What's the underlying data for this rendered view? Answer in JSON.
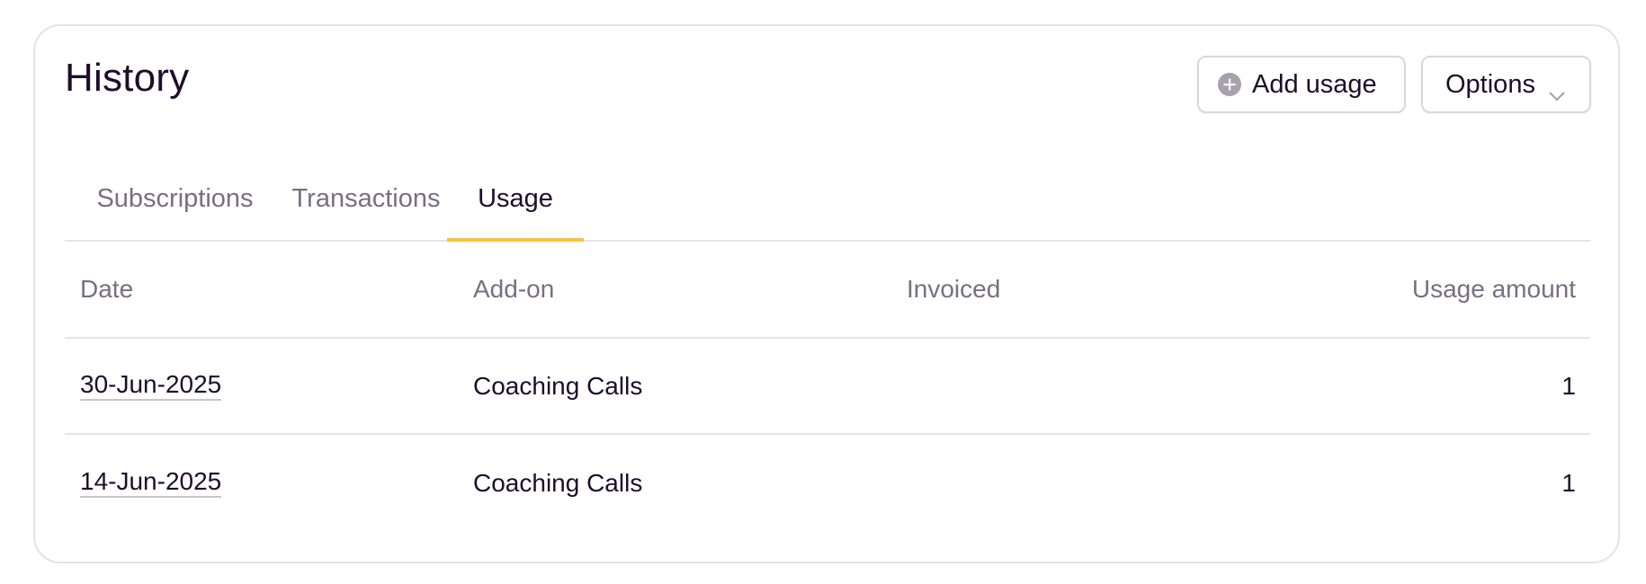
{
  "header": {
    "title": "History",
    "add_usage_label": "Add usage",
    "options_label": "Options"
  },
  "tabs": [
    {
      "label": "Subscriptions",
      "active": false
    },
    {
      "label": "Transactions",
      "active": false
    },
    {
      "label": "Usage",
      "active": true
    }
  ],
  "table": {
    "columns": [
      "Date",
      "Add-on",
      "Invoiced",
      "Usage amount"
    ],
    "rows": [
      {
        "date": "30-Jun-2025",
        "addon": "Coaching Calls",
        "invoiced": "",
        "amount": "1"
      },
      {
        "date": "14-Jun-2025",
        "addon": "Coaching Calls",
        "invoiced": "",
        "amount": "1"
      }
    ]
  },
  "icons": {
    "add": "plus-circle-icon",
    "options": "chevron-down-icon"
  },
  "colors": {
    "text": "#1f0d2b",
    "muted": "#7a6e82",
    "accent": "#f4c542",
    "border": "#e4e2e6",
    "icon": "#a7a0ad"
  }
}
